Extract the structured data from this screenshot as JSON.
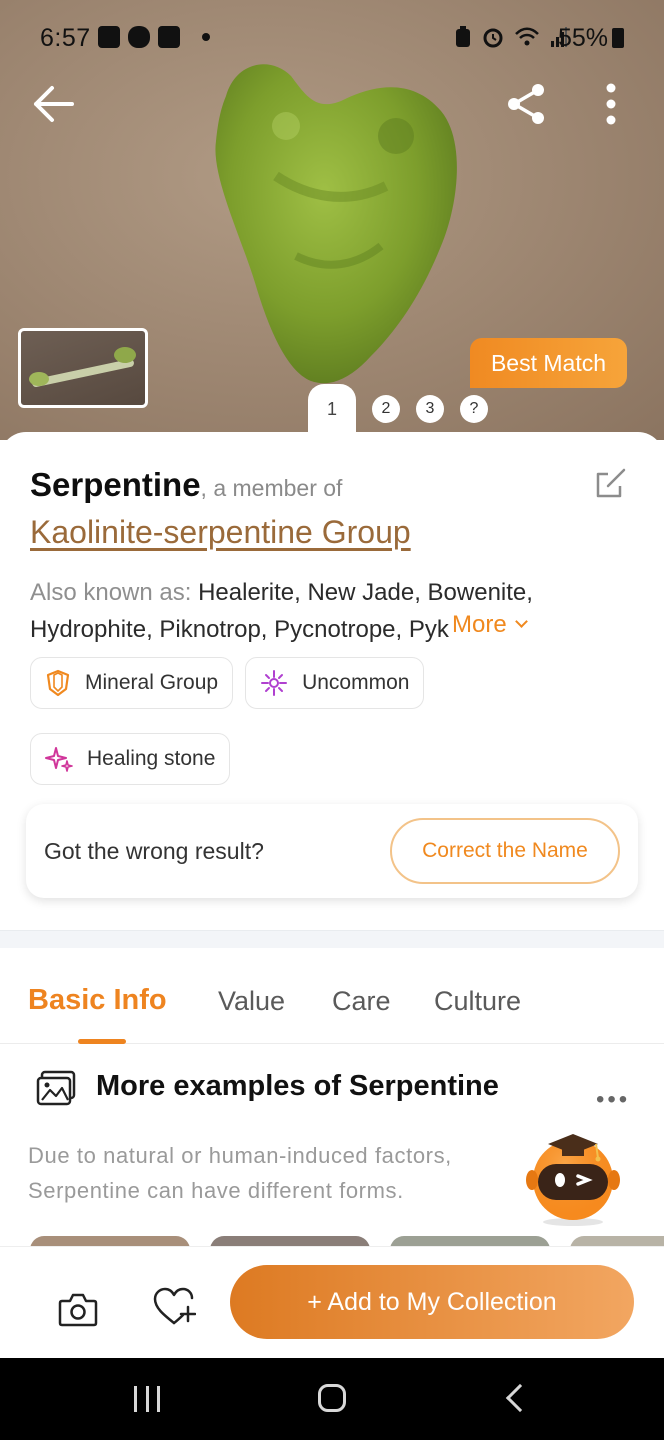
{
  "status_bar": {
    "time": "6:57",
    "battery": "55%"
  },
  "hero": {
    "badge": "Best Match",
    "pager": [
      "1",
      "2",
      "3",
      "?"
    ],
    "active_page": 1
  },
  "header": {
    "name": "Serpentine",
    "member_of": ", a member of",
    "group": "Kaolinite-serpentine Group"
  },
  "aka": {
    "label": "Also known as: ",
    "names": "Healerite, New Jade, Bowenite, Hydrophite, Piknotrop, Pycnotrope, Pykr",
    "more": "More"
  },
  "tags": [
    {
      "label": "Mineral Group",
      "icon": "shield-icon"
    },
    {
      "label": "Uncommon",
      "icon": "sparkle-icon"
    },
    {
      "label": "Healing stone",
      "icon": "stars-icon"
    }
  ],
  "feedback": {
    "question": "Got the wrong result?",
    "button": "Correct the Name"
  },
  "tabs": [
    "Basic Info",
    "Value",
    "Care",
    "Culture"
  ],
  "active_tab": "Basic Info",
  "examples": {
    "title": "More examples of Serpentine",
    "more": "•••",
    "description": "Due to natural or human-induced factors, Serpentine can have different forms."
  },
  "actions": {
    "add": "+ Add to My Collection"
  },
  "colors": {
    "accent": "#f0891f",
    "link": "#9a6a3a",
    "jade": "#7f9f2e"
  }
}
